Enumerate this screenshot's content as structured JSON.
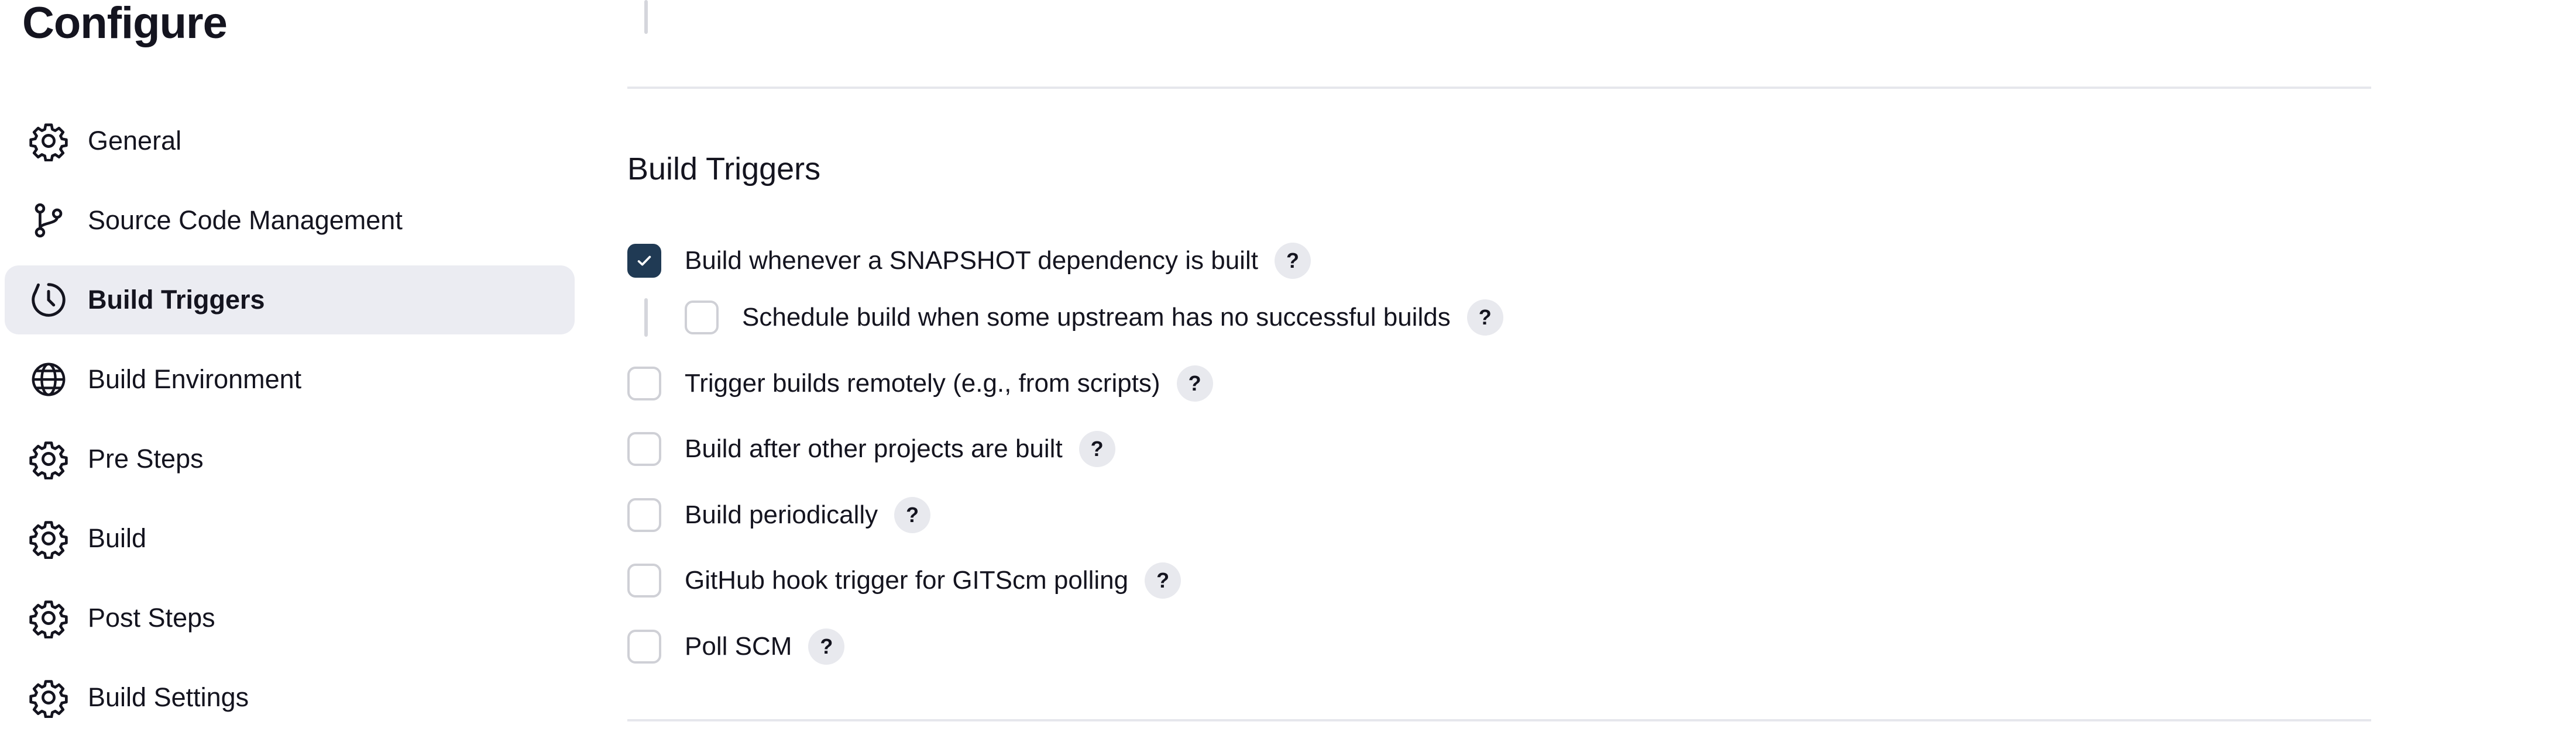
{
  "page": {
    "title": "Configure"
  },
  "sidebar": {
    "items": [
      {
        "label": "General",
        "icon": "gear-icon",
        "active": false
      },
      {
        "label": "Source Code Management",
        "icon": "git-branch-icon",
        "active": false
      },
      {
        "label": "Build Triggers",
        "icon": "timer-icon",
        "active": true
      },
      {
        "label": "Build Environment",
        "icon": "globe-icon",
        "active": false
      },
      {
        "label": "Pre Steps",
        "icon": "gear-icon",
        "active": false
      },
      {
        "label": "Build",
        "icon": "gear-icon",
        "active": false
      },
      {
        "label": "Post Steps",
        "icon": "gear-icon",
        "active": false
      },
      {
        "label": "Build Settings",
        "icon": "gear-icon",
        "active": false
      }
    ]
  },
  "main": {
    "section_title": "Build Triggers",
    "help_label": "?",
    "options": [
      {
        "label": "Build whenever a SNAPSHOT dependency is built",
        "checked": true
      },
      {
        "label": "Schedule build when some upstream has no successful builds",
        "checked": false
      },
      {
        "label": "Trigger builds remotely (e.g., from scripts)",
        "checked": false
      },
      {
        "label": "Build after other projects are built",
        "checked": false
      },
      {
        "label": "Build periodically",
        "checked": false
      },
      {
        "label": "GitHub hook trigger for GITScm polling",
        "checked": false
      },
      {
        "label": "Poll SCM",
        "checked": false
      }
    ]
  },
  "colors": {
    "accent": "#203a54",
    "active_bg": "#ebecf2",
    "divider": "#e6e7ec"
  }
}
